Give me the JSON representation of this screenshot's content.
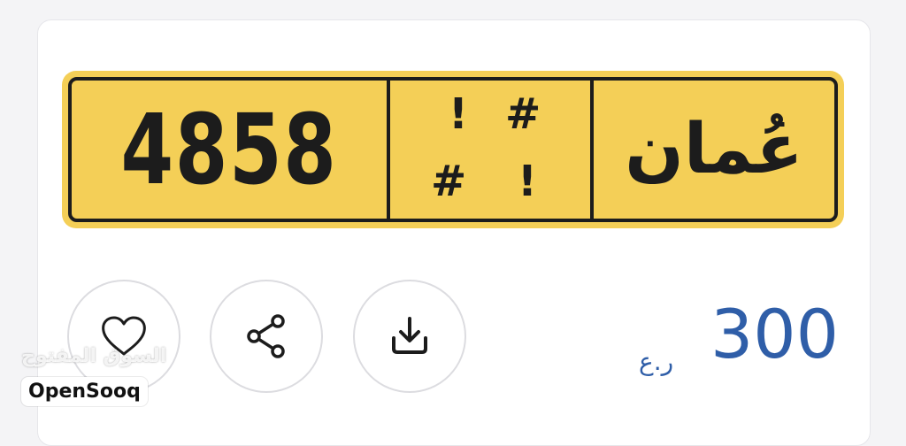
{
  "plate": {
    "number": "4858",
    "code_chars": [
      "!",
      "#",
      "#",
      "!"
    ],
    "country": "عُمان",
    "colors": {
      "background": "#f4cf57",
      "border": "#1c1c1c"
    }
  },
  "actions": {
    "favorite_icon": "heart-icon",
    "share_icon": "share-icon",
    "download_icon": "download-icon"
  },
  "listing": {
    "price": "300",
    "currency": "ر.ع",
    "price_color": "#2f5ea8"
  },
  "watermark": {
    "arabic": "السوق المفتوح",
    "brand": "OpenSooq"
  }
}
